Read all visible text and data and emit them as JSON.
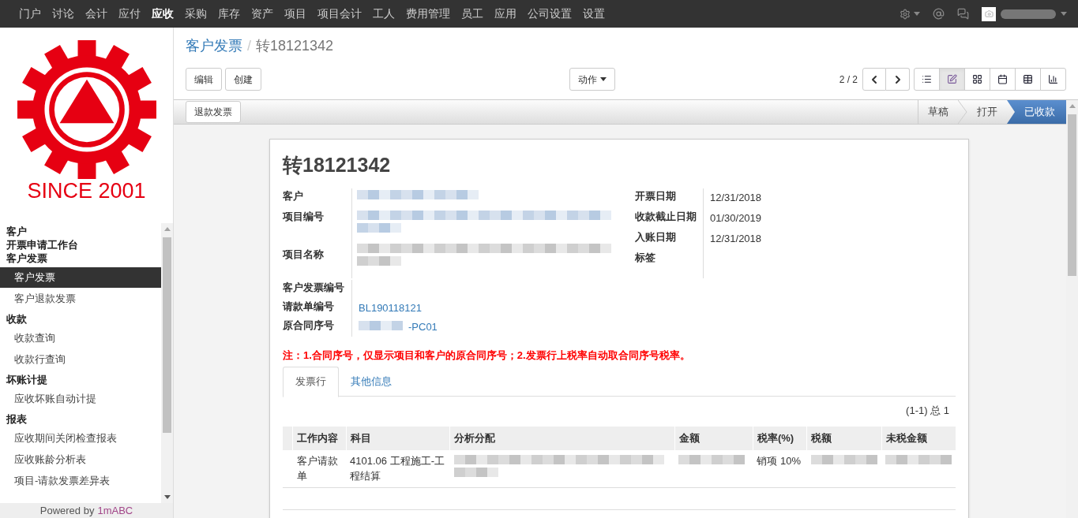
{
  "top_menu": [
    {
      "label": "门户",
      "selected": false
    },
    {
      "label": "讨论",
      "selected": false
    },
    {
      "label": "会计",
      "selected": false
    },
    {
      "label": "应付",
      "selected": false
    },
    {
      "label": "应收",
      "selected": true
    },
    {
      "label": "采购",
      "selected": false
    },
    {
      "label": "库存",
      "selected": false
    },
    {
      "label": "资产",
      "selected": false
    },
    {
      "label": "项目",
      "selected": false
    },
    {
      "label": "项目会计",
      "selected": false
    },
    {
      "label": "工人",
      "selected": false
    },
    {
      "label": "费用管理",
      "selected": false
    },
    {
      "label": "员工",
      "selected": false
    },
    {
      "label": "应用",
      "selected": false
    },
    {
      "label": "公司设置",
      "selected": false
    },
    {
      "label": "设置",
      "selected": false
    }
  ],
  "logo": {
    "text": "SINCE 2001"
  },
  "sidebar": {
    "sections": [
      {
        "title": "客户"
      },
      {
        "title": "开票申请工作台"
      },
      {
        "title": "客户发票",
        "items": [
          {
            "label": "客户发票",
            "selected": true
          },
          {
            "label": "客户退款发票",
            "selected": false
          }
        ]
      },
      {
        "title": "收款",
        "items": [
          {
            "label": "收款查询",
            "selected": false
          },
          {
            "label": "收款行查询",
            "selected": false
          }
        ]
      },
      {
        "title": "坏账计提",
        "items": [
          {
            "label": "应收坏账自动计提",
            "selected": false
          }
        ]
      },
      {
        "title": "报表",
        "items": [
          {
            "label": "应收期间关闭检查报表",
            "selected": false
          },
          {
            "label": "应收账龄分析表",
            "selected": false
          },
          {
            "label": "项目-请款发票差异表",
            "selected": false
          }
        ]
      }
    ]
  },
  "powered_by": {
    "text": "Powered by",
    "brand": "1mABC"
  },
  "breadcrumb": {
    "parent": "客户发票",
    "separator": "/",
    "current": "转18121342"
  },
  "buttons": [
    "编辑",
    "创建"
  ],
  "action_menu": "动作",
  "pager": "2 / 2",
  "view_modes": [
    {
      "kind": "list",
      "selected": false
    },
    {
      "kind": "form",
      "selected": true
    },
    {
      "kind": "kanban",
      "selected": false
    },
    {
      "kind": "calendar",
      "selected": false
    },
    {
      "kind": "pivot",
      "selected": false
    },
    {
      "kind": "graph",
      "selected": false
    }
  ],
  "header_buttons": [
    "退款发票"
  ],
  "stages": [
    {
      "label": "草稿",
      "selected": false
    },
    {
      "label": "打开",
      "selected": false
    },
    {
      "label": "已收款",
      "selected": true
    }
  ],
  "record": {
    "title": "转18121342",
    "left_fields": [
      {
        "label": "客户",
        "kind": "redacted"
      },
      {
        "label": "项目编号",
        "kind": "redacted_long"
      },
      {
        "label": "项目名称",
        "kind": "redacted_long"
      }
    ],
    "right_fields": [
      {
        "label": "开票日期",
        "value": "12/31/2018"
      },
      {
        "label": "收款截止日期",
        "value": "01/30/2019"
      },
      {
        "label": "入账日期",
        "value": "12/31/2018"
      },
      {
        "label": "标签"
      }
    ],
    "lower_fields": [
      {
        "label": "客户发票编号",
        "kind": "empty"
      },
      {
        "label": "请款单编号",
        "kind": "link",
        "value": "BL190118121"
      },
      {
        "label": "原合同序号",
        "kind": "partly_redacted",
        "value": "-PC01"
      }
    ],
    "note": "注：1.合同序号，仅显示项目和客户的原合同序号；2.发票行上税率自动取合同序号税率。",
    "tabs": [
      {
        "label": "发票行",
        "selected": true
      },
      {
        "label": "其他信息",
        "selected": false
      }
    ],
    "lines_pager": "(1-1) 总 1",
    "table": {
      "columns": [
        "工作内容",
        "科目",
        "分析分配",
        "金额",
        "税率(%)",
        "税额",
        "未税金额"
      ],
      "rows": [
        {
          "cells": [
            {
              "kind": "text",
              "text": "客户请款单"
            },
            {
              "kind": "text",
              "text": "4101.06 工程施工-工程结算"
            },
            {
              "kind": "redacted"
            },
            {
              "kind": "redacted"
            },
            {
              "kind": "text",
              "text": "销项 10%"
            },
            {
              "kind": "redacted"
            },
            {
              "kind": "redacted"
            }
          ]
        }
      ]
    }
  }
}
